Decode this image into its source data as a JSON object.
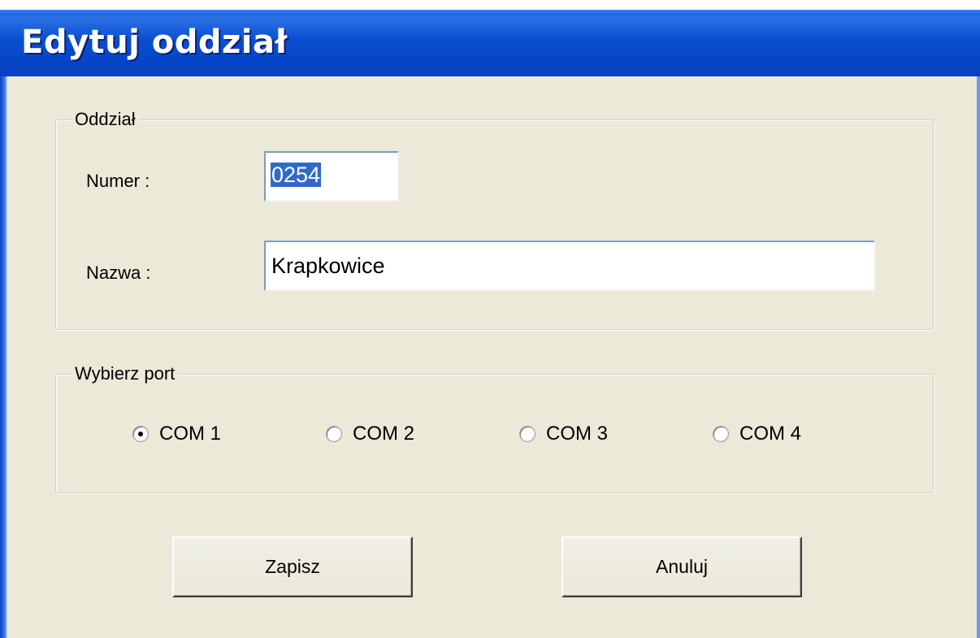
{
  "window": {
    "title": "Edytuj oddział"
  },
  "branch_group": {
    "legend": "Oddział",
    "number_label": "Numer :",
    "number_value": "0254",
    "name_label": "Nazwa :",
    "name_value": "Krapkowice"
  },
  "port_group": {
    "legend": "Wybierz port",
    "options": [
      {
        "label": "COM 1",
        "checked": true
      },
      {
        "label": "COM 2",
        "checked": false
      },
      {
        "label": "COM 3",
        "checked": false
      },
      {
        "label": "COM 4",
        "checked": false
      }
    ]
  },
  "buttons": {
    "save_label": "Zapisz",
    "cancel_label": "Anuluj"
  },
  "colors": {
    "titlebar": "#0a4fd0",
    "dialog_background": "#ece9d8",
    "selection": "#316ac5"
  }
}
